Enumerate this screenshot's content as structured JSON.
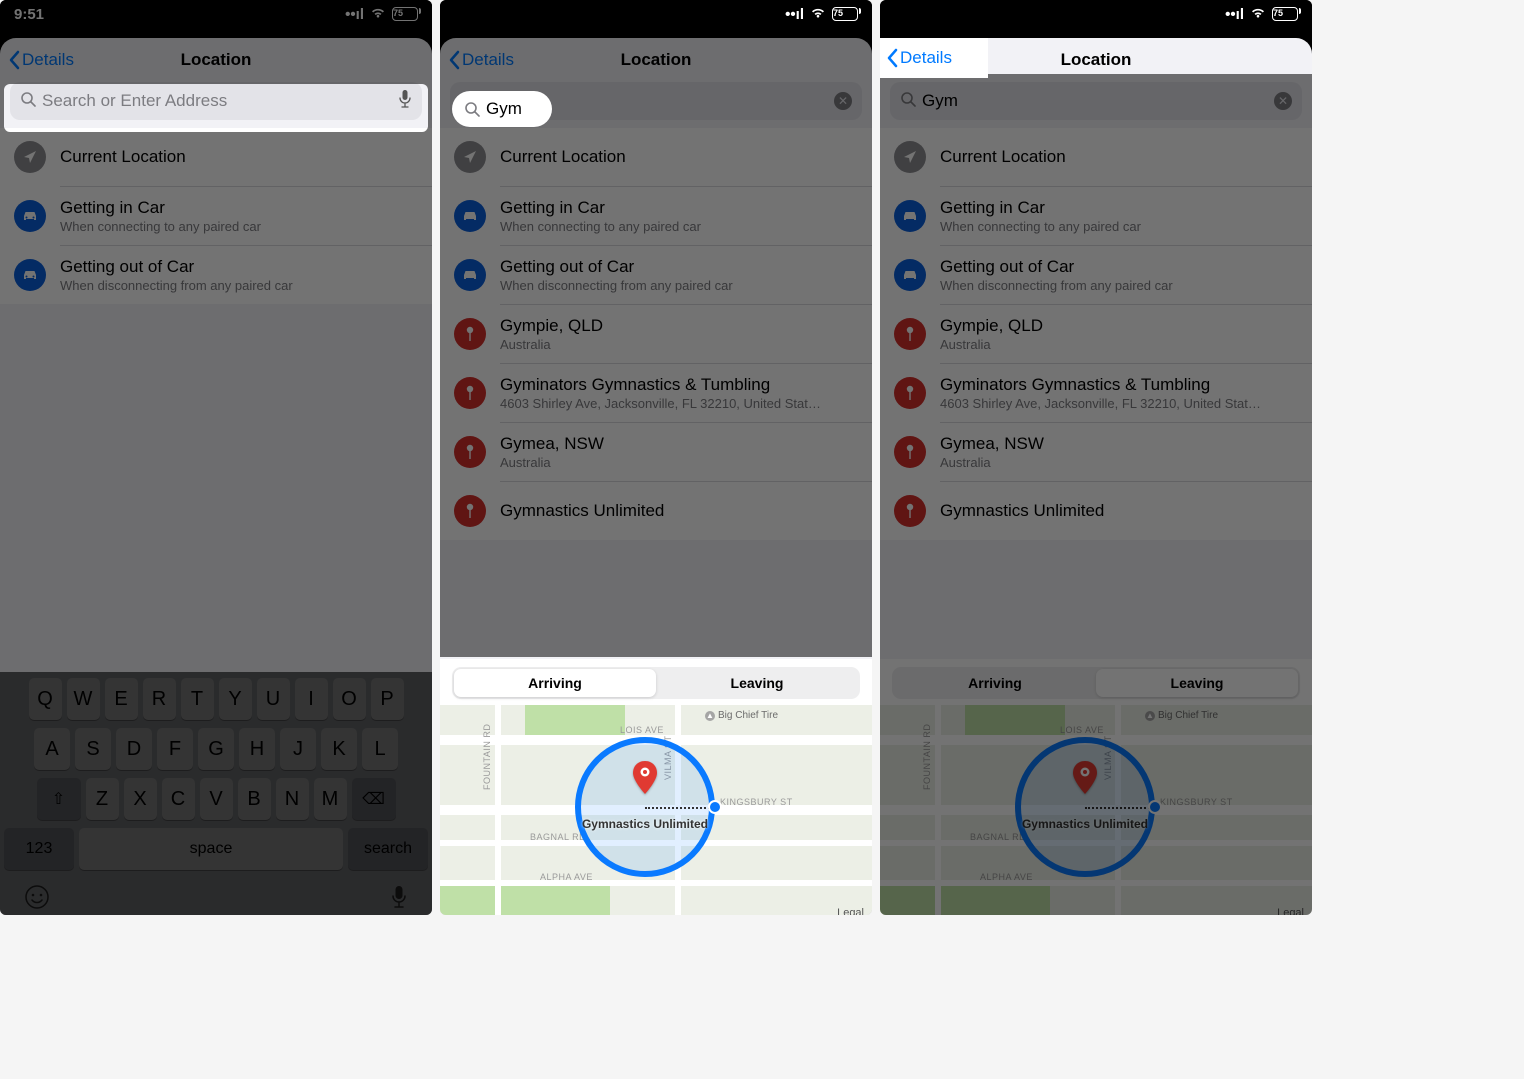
{
  "status": {
    "time": "9:51",
    "battery": "75"
  },
  "nav": {
    "back": "Details",
    "title": "Location"
  },
  "search": {
    "placeholder": "Search or Enter Address",
    "value": "Gym"
  },
  "quick": {
    "currentLocation": "Current Location",
    "gettingIn": {
      "title": "Getting in Car",
      "sub": "When connecting to any paired car"
    },
    "gettingOut": {
      "title": "Getting out of Car",
      "sub": "When disconnecting from any paired car"
    }
  },
  "results": [
    {
      "title": "Gympie, QLD",
      "sub": "Australia"
    },
    {
      "title": "Gyminators Gymnastics & Tumbling",
      "sub": "4603 Shirley Ave, Jacksonville, FL  32210, United Stat…"
    },
    {
      "title": "Gymea, NSW",
      "sub": "Australia"
    },
    {
      "title": "Gymnastics Unlimited",
      "sub": ""
    }
  ],
  "segmented": {
    "arriving": "Arriving",
    "leaving": "Leaving"
  },
  "map": {
    "legal": "Legal",
    "poi": "Big Chief Tire",
    "pinLabel": "Gymnastics Unlimited",
    "streets": {
      "lois": "LOIS AVE",
      "kingsbury": "KINGSBURY ST",
      "bagnal": "BAGNAL RD",
      "alpha": "ALPHA AVE",
      "fountain": "FOUNTAIN RD",
      "vilma": "VILMA ST"
    }
  },
  "keyboard": {
    "r1": [
      "Q",
      "W",
      "E",
      "R",
      "T",
      "Y",
      "U",
      "I",
      "O",
      "P"
    ],
    "r2": [
      "A",
      "S",
      "D",
      "F",
      "G",
      "H",
      "J",
      "K",
      "L"
    ],
    "r3": [
      "Z",
      "X",
      "C",
      "V",
      "B",
      "N",
      "M"
    ],
    "shift": "⇧",
    "bksp": "⌫",
    "num": "123",
    "space": "space",
    "search": "search"
  }
}
